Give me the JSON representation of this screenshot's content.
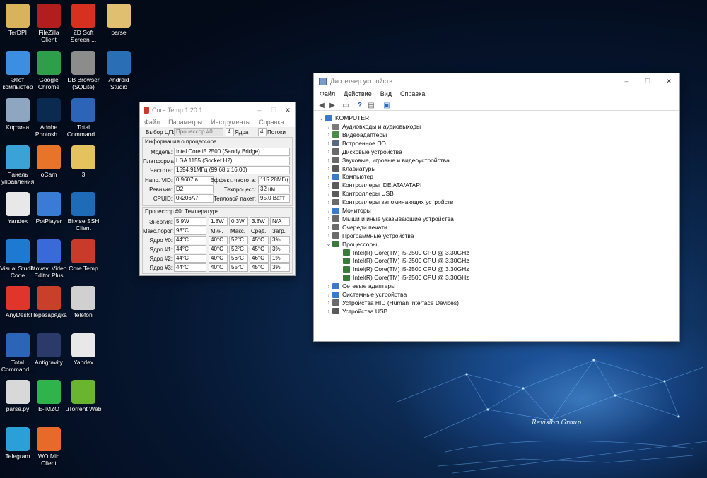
{
  "desktop": {
    "wallpaper_brand": "Revision Group",
    "icons": [
      {
        "label": "TerDPI",
        "icon": "folder-user-icon",
        "color": "#d9b35c"
      },
      {
        "label": "FileZilla\nClient",
        "icon": "filezilla-icon",
        "color": "#b21e1e"
      },
      {
        "label": "ZD Soft\nScreen ...",
        "icon": "zd-soft-icon",
        "color": "#d8301f"
      },
      {
        "label": "parse",
        "icon": "file-icon",
        "color": "#e0c070"
      },
      {
        "label": "Этот\nкомпьютер",
        "icon": "computer-icon",
        "color": "#3b8ee0"
      },
      {
        "label": "Google\nChrome",
        "icon": "chrome-icon",
        "color": "#2f9e4a"
      },
      {
        "label": "DB Browser\n(SQLite)",
        "icon": "database-icon",
        "color": "#8c8c8c"
      },
      {
        "label": "Android\nStudio",
        "icon": "android-studio-icon",
        "color": "#2a6fb5"
      },
      {
        "label": "Корзина",
        "icon": "recycle-bin-icon",
        "color": "#8ea6bf"
      },
      {
        "label": "Adobe\nPhotosh...",
        "icon": "photoshop-icon",
        "color": "#0a2a4f"
      },
      {
        "label": "Total\nCommand...",
        "icon": "total-commander-icon",
        "color": "#2c64b8"
      },
      {
        "label": "Панель\nуправления",
        "icon": "control-panel-icon",
        "color": "#3aa2d6"
      },
      {
        "label": "oCam",
        "icon": "ocam-icon",
        "color": "#e8742a"
      },
      {
        "label": "3",
        "icon": "folder-icon",
        "color": "#e4c25e"
      },
      {
        "label": "Yandex",
        "icon": "yandex-icon",
        "color": "#e8e8e8"
      },
      {
        "label": "PotPlayer",
        "icon": "potplayer-icon",
        "color": "#3a7bd5"
      },
      {
        "label": "Bitvise SSH\nClient",
        "icon": "bitvise-icon",
        "color": "#1e6bb8"
      },
      {
        "label": "Visual Studio\nCode",
        "icon": "vscode-icon",
        "color": "#1e7ad0"
      },
      {
        "label": "Movavi Video\nEditor Plus",
        "icon": "movavi-icon",
        "color": "#3a6ad8"
      },
      {
        "label": "Core Temp",
        "icon": "thermometer-icon",
        "color": "#c83a2a"
      },
      {
        "label": "AnyDesk",
        "icon": "anydesk-icon",
        "color": "#e0352b"
      },
      {
        "label": "Перезарядка",
        "icon": "game-icon",
        "color": "#c8402a"
      },
      {
        "label": "telefon",
        "icon": "file-gear-icon",
        "color": "#d0d0d0"
      },
      {
        "label": "Total\nCommand...",
        "icon": "total-commander-icon",
        "color": "#2c64b8"
      },
      {
        "label": "Antigravity",
        "icon": "antigravity-icon",
        "color": "#2c3a6a"
      },
      {
        "label": "Yandex",
        "icon": "yandex-icon",
        "color": "#e8e8e8"
      },
      {
        "label": "parse.py",
        "icon": "python-icon",
        "color": "#d8d8d8"
      },
      {
        "label": "E-IMZO",
        "icon": "eimzo-icon",
        "color": "#2fb34a"
      },
      {
        "label": "uTorrent Web",
        "icon": "utorrent-icon",
        "color": "#6ab52f"
      },
      {
        "label": "Telegram",
        "icon": "telegram-icon",
        "color": "#2a9fd8"
      },
      {
        "label": "WO Mic\nClient",
        "icon": "microphone-icon",
        "color": "#e86a2a"
      }
    ]
  },
  "coretemp": {
    "title": "Core Temp 1.20.1",
    "menu": [
      "Файл",
      "Параметры",
      "Инструменты",
      "Справка"
    ],
    "cpu_select_label": "Выбор ЦП:",
    "cpu_select_value": "Процессор #0",
    "cores_count": "4",
    "cores_label": "Ядра",
    "threads_count": "4",
    "threads_label": "Потоки",
    "info_header": "Информация о процессоре",
    "model_label": "Модель:",
    "model_value": "Intel Core i5 2500 (Sandy Bridge)",
    "platform_label": "Платформа:",
    "platform_value": "LGA 1155 (Socket H2)",
    "freq_label": "Частота:",
    "freq_value": "1594.91МГц (99.68 x 16.00)",
    "vid_label": "Напр. VID:",
    "vid_value": "0.9607 в",
    "eff_freq_label": "Эффект. частота:",
    "eff_freq_value": "115.28МГц",
    "revision_label": "Ревизия:",
    "revision_value": "D2",
    "process_label": "Техпроцесс:",
    "process_value": "32 нм",
    "cpuid_label": "CPUID:",
    "cpuid_value": "0x206A7",
    "tdp_label": "Тепловой пакет:",
    "tdp_value": "95.0 Ватт",
    "temp_header": "Процессор #0: Температура",
    "power_label": "Энергия:",
    "power_values": [
      "5.9W",
      "1.8W",
      "0.3W",
      "3.8W",
      "N/A"
    ],
    "tjmax_label": "Макс.порог:",
    "tjmax_value": "98°C",
    "col_headers": [
      "Мин.",
      "Макс.",
      "Сред.",
      "Загр."
    ],
    "cores": [
      {
        "label": "Ядро #0:",
        "temp": "44°C",
        "min": "40°C",
        "max": "52°C",
        "avg": "45°C",
        "load": "3%"
      },
      {
        "label": "Ядро #1:",
        "temp": "44°C",
        "min": "40°C",
        "max": "52°C",
        "avg": "45°C",
        "load": "3%"
      },
      {
        "label": "Ядро #2:",
        "temp": "44°C",
        "min": "40°C",
        "max": "56°C",
        "avg": "46°C",
        "load": "1%"
      },
      {
        "label": "Ядро #3:",
        "temp": "44°C",
        "min": "40°C",
        "max": "55°C",
        "avg": "45°C",
        "load": "3%"
      }
    ]
  },
  "devmgr": {
    "title": "Диспетчер устройств",
    "menu": [
      "Файл",
      "Действие",
      "Вид",
      "Справка"
    ],
    "root": "KOMPUTER",
    "categories": [
      {
        "label": "Аудиовходы и аудиовыходы",
        "icon": "audio-icon",
        "color": "#7a7a7a",
        "expanded": false
      },
      {
        "label": "Видеоадаптеры",
        "icon": "display-adapter-icon",
        "color": "#4a8a4a",
        "expanded": false
      },
      {
        "label": "Встроенное ПО",
        "icon": "firmware-icon",
        "color": "#5a6a7a",
        "expanded": false
      },
      {
        "label": "Дисковые устройства",
        "icon": "disk-icon",
        "color": "#6a6a6a",
        "expanded": false
      },
      {
        "label": "Звуковые, игровые и видеоустройства",
        "icon": "sound-icon",
        "color": "#6a6a6a",
        "expanded": false
      },
      {
        "label": "Клавиатуры",
        "icon": "keyboard-icon",
        "color": "#5a5a5a",
        "expanded": false
      },
      {
        "label": "Компьютер",
        "icon": "computer-icon",
        "color": "#3a7ac8",
        "expanded": false
      },
      {
        "label": "Контроллеры IDE ATA/ATAPI",
        "icon": "ide-icon",
        "color": "#5a5a5a",
        "expanded": false
      },
      {
        "label": "Контроллеры USB",
        "icon": "usb-icon",
        "color": "#5a5a5a",
        "expanded": false
      },
      {
        "label": "Контроллеры запоминающих устройств",
        "icon": "storage-icon",
        "color": "#6a6a6a",
        "expanded": false
      },
      {
        "label": "Мониторы",
        "icon": "monitor-icon",
        "color": "#3a7ac8",
        "expanded": false
      },
      {
        "label": "Мыши и иные указывающие устройства",
        "icon": "mouse-icon",
        "color": "#6a6a6a",
        "expanded": false
      },
      {
        "label": "Очереди печати",
        "icon": "printer-icon",
        "color": "#6a6a6a",
        "expanded": false
      },
      {
        "label": "Программные устройства",
        "icon": "software-device-icon",
        "color": "#6a6a6a",
        "expanded": false
      },
      {
        "label": "Процессоры",
        "icon": "processor-icon",
        "color": "#3a7a3a",
        "expanded": true
      },
      {
        "label": "Сетевые адаптеры",
        "icon": "network-icon",
        "color": "#3a7ac8",
        "expanded": false
      },
      {
        "label": "Системные устройства",
        "icon": "system-icon",
        "color": "#3a7ac8",
        "expanded": false
      },
      {
        "label": "Устройства HID (Human Interface Devices)",
        "icon": "hid-icon",
        "color": "#6a6a6a",
        "expanded": false
      },
      {
        "label": "Устройства USB",
        "icon": "usb-device-icon",
        "color": "#5a5a5a",
        "expanded": false
      }
    ],
    "processors": [
      "Intel(R) Core(TM) i5-2500 CPU @ 3.30GHz",
      "Intel(R) Core(TM) i5-2500 CPU @ 3.30GHz",
      "Intel(R) Core(TM) i5-2500 CPU @ 3.30GHz",
      "Intel(R) Core(TM) i5-2500 CPU @ 3.30GHz"
    ]
  }
}
